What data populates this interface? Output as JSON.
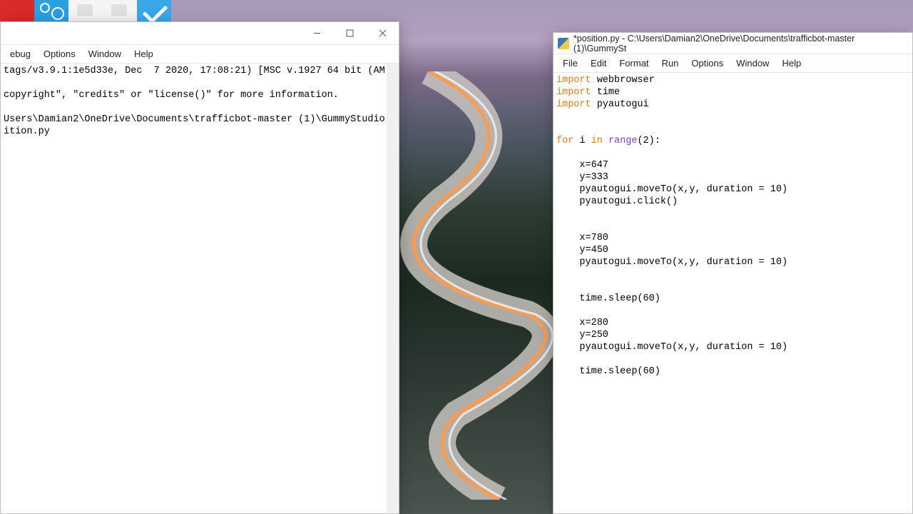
{
  "left_window": {
    "menus": [
      "ebug",
      "Options",
      "Window",
      "Help"
    ],
    "shell_lines": [
      "tags/v3.9.1:1e5d33e, Dec  7 2020, 17:08:21) [MSC v.1927 64 bit (AM",
      "",
      "copyright\", \"credits\" or \"license()\" for more information.",
      "",
      "Users\\Damian2\\OneDrive\\Documents\\trafficbot-master (1)\\GummyStudio",
      "ition.py"
    ]
  },
  "right_window": {
    "title": "*position.py - C:\\Users\\Damian2\\OneDrive\\Documents\\trafficbot-master (1)\\GummySt",
    "menus": [
      "File",
      "Edit",
      "Format",
      "Run",
      "Options",
      "Window",
      "Help"
    ],
    "code": [
      {
        "t": "import",
        "c": "kw-orange"
      },
      {
        "t": " webbrowser\n",
        "c": ""
      },
      {
        "t": "import",
        "c": "kw-orange"
      },
      {
        "t": " time\n",
        "c": ""
      },
      {
        "t": "import",
        "c": "kw-orange"
      },
      {
        "t": " pyautogui\n",
        "c": ""
      },
      {
        "t": "\n",
        "c": ""
      },
      {
        "t": "\n",
        "c": ""
      },
      {
        "t": "for",
        "c": "kw-orange"
      },
      {
        "t": " i ",
        "c": ""
      },
      {
        "t": "in",
        "c": "kw-orange"
      },
      {
        "t": " ",
        "c": ""
      },
      {
        "t": "range",
        "c": "kw-purple"
      },
      {
        "t": "(2):\n",
        "c": ""
      },
      {
        "t": "\n",
        "c": ""
      },
      {
        "t": "    x=647\n",
        "c": ""
      },
      {
        "t": "    y=333\n",
        "c": ""
      },
      {
        "t": "    pyautogui.moveTo(x,y, duration = 10)\n",
        "c": ""
      },
      {
        "t": "    pyautogui.click()\n",
        "c": ""
      },
      {
        "t": "\n",
        "c": ""
      },
      {
        "t": "\n",
        "c": ""
      },
      {
        "t": "    x=780\n",
        "c": ""
      },
      {
        "t": "    y=450\n",
        "c": ""
      },
      {
        "t": "    pyautogui.moveTo(x,y, duration = 10)\n",
        "c": ""
      },
      {
        "t": "\n",
        "c": ""
      },
      {
        "t": "\n",
        "c": ""
      },
      {
        "t": "    time.sleep(60)\n",
        "c": ""
      },
      {
        "t": "\n",
        "c": ""
      },
      {
        "t": "    x=280\n",
        "c": ""
      },
      {
        "t": "    y=250\n",
        "c": ""
      },
      {
        "t": "    pyautogui.moveTo(x,y, duration = 10)\n",
        "c": ""
      },
      {
        "t": "\n",
        "c": ""
      },
      {
        "t": "    time.sleep(60)\n",
        "c": ""
      }
    ]
  }
}
